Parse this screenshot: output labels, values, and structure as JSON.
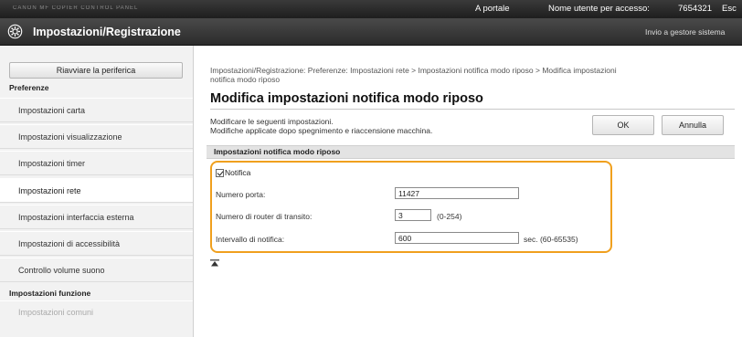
{
  "topbar": {
    "logo_strip": "CANON MF COPIER   CONTROL PANEL",
    "portal": "A portale",
    "user_label": "Nome utente per accesso:",
    "user_id": "7654321",
    "logout": "Esc"
  },
  "header": {
    "title": "Impostazioni/Registrazione",
    "admin_link": "Invio a gestore sistema"
  },
  "sidebar": {
    "restart_button": "Riavviare la periferica",
    "section_preferences": "Preferenze",
    "items": [
      {
        "label": "Impostazioni carta"
      },
      {
        "label": "Impostazioni visualizzazione"
      },
      {
        "label": "Impostazioni timer"
      },
      {
        "label": "Impostazioni rete"
      },
      {
        "label": "Impostazioni interfaccia esterna"
      },
      {
        "label": "Impostazioni di accessibilità"
      },
      {
        "label": "Controllo volume suono"
      }
    ],
    "section_functions": "Impostazioni funzione",
    "common_item": "Impostazioni comuni"
  },
  "main": {
    "breadcrumb_line1": "Impostazioni/Registrazione: Preferenze: Impostazioni rete > Impostazioni notifica modo riposo > Modifica impostazioni",
    "breadcrumb_line2": "notifica modo riposo",
    "title": "Modifica impostazioni notifica modo riposo",
    "desc_line1": "Modificare le seguenti impostazioni.",
    "desc_line2": "Modifiche applicate dopo spegnimento e riaccensione macchina.",
    "ok_button": "OK",
    "cancel_button": "Annulla",
    "panel_title": "Impostazioni notifica modo riposo",
    "notification_label": "Notifica",
    "notification_checked": true,
    "port_label": "Numero porta:",
    "port_value": "11427",
    "router_label": "Numero di router di transito:",
    "router_value": "3",
    "router_hint": "(0-254)",
    "interval_label": "Intervallo di notifica:",
    "interval_value": "600",
    "interval_hint": "sec. (60-65535)"
  },
  "colors": {
    "highlight": "#f0a01e",
    "header_bg": "#2b2b2b",
    "sidebar_bg": "#f2f2f2",
    "panel_head_bg": "#e3e3e3"
  }
}
